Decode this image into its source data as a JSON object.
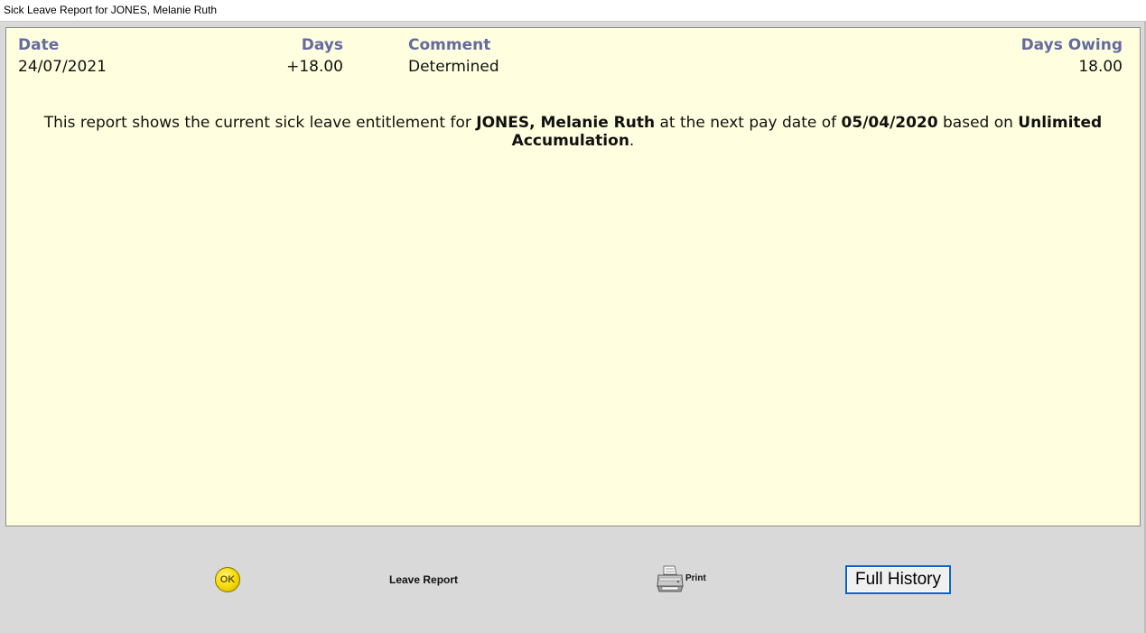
{
  "window": {
    "title": "Sick Leave Report for JONES, Melanie Ruth"
  },
  "table": {
    "headers": {
      "date": "Date",
      "days": "Days",
      "comment": "Comment",
      "days_owing": "Days Owing"
    },
    "rows": [
      {
        "date": "24/07/2021",
        "days": "+18.00",
        "comment": "Determined",
        "days_owing": "18.00"
      }
    ]
  },
  "summary": {
    "text_1": "This report shows the current sick leave entitlement for ",
    "employee": "JONES, Melanie Ruth",
    "text_2": " at the next pay date of ",
    "pay_date": "05/04/2020",
    "text_3": " based on ",
    "basis": "Unlimited Accumulation",
    "text_4": "."
  },
  "buttons": {
    "ok_label": "OK",
    "leave_report_label": "Leave Report",
    "print_label": "Print",
    "full_history_label": "Full History"
  },
  "colors": {
    "panel_background": "#ffffe0",
    "header_text": "#636ba0",
    "window_background": "#d9d9d9",
    "focus_border": "#0a64c8",
    "ok_button": "#f4d800"
  },
  "icons": {
    "ok": "ok-icon",
    "print": "printer-icon"
  }
}
